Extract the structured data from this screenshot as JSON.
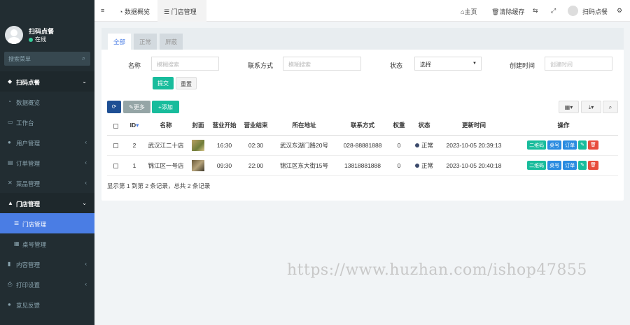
{
  "sidebar": {
    "user_name": "扫码点餐",
    "user_status": "在线",
    "search_placeholder": "搜索菜单",
    "items": [
      {
        "label": "扫码点餐",
        "icon": "cubes-icon"
      },
      {
        "label": "数据概览",
        "icon": "dashboard-icon"
      },
      {
        "label": "工作台",
        "icon": "desktop-icon"
      },
      {
        "label": "用户管理",
        "icon": "user-icon"
      },
      {
        "label": "订单管理",
        "icon": "list-icon"
      },
      {
        "label": "菜品管理",
        "icon": "cutlery-icon"
      },
      {
        "label": "门店管理",
        "icon": "store-icon"
      },
      {
        "label": "门店管理",
        "icon": "list-icon"
      },
      {
        "label": "桌号管理",
        "icon": "grid-icon"
      },
      {
        "label": "内容管理",
        "icon": "book-icon"
      },
      {
        "label": "打印设置",
        "icon": "printer-icon"
      },
      {
        "label": "意见反馈",
        "icon": "comment-icon"
      }
    ]
  },
  "topbar": {
    "tab1": "数据概览",
    "tab2": "门店管理",
    "home": "主页",
    "clear_cache": "清除缓存",
    "username": "扫码点餐"
  },
  "filter_tabs": [
    "全部",
    "正常",
    "屏蔽"
  ],
  "form": {
    "name_label": "名称",
    "name_placeholder": "模糊搜索",
    "contact_label": "联系方式",
    "contact_placeholder": "模糊搜索",
    "status_label": "状态",
    "status_value": "选择",
    "created_label": "创建时间",
    "created_placeholder": "创建时间",
    "submit": "提交",
    "reset": "重置"
  },
  "toolbar": {
    "more": "更多",
    "add": "添加"
  },
  "table": {
    "headers": [
      "ID",
      "名称",
      "封面",
      "营业开始",
      "营业结束",
      "所在地址",
      "联系方式",
      "权重",
      "状态",
      "更新时间",
      "操作"
    ],
    "rows": [
      {
        "id": "2",
        "name": "武汉江二十店",
        "start": "16:30",
        "end": "02:30",
        "address": "武汉东湖门路20号",
        "phone": "028-88881888",
        "weight": "0",
        "status": "正常",
        "updated": "2023-10-05 20:39:13"
      },
      {
        "id": "1",
        "name": "锦江区一号店",
        "start": "09:30",
        "end": "22:00",
        "address": "锦江区东大街15号",
        "phone": "13818881888",
        "weight": "0",
        "status": "正常",
        "updated": "2023-10-05 20:40:18"
      }
    ],
    "ops": [
      "二维码",
      "桌号",
      "订单"
    ]
  },
  "pager": "显示第 1 到第 2 条记录，总共 2 条记录",
  "watermark": "https://www.huzhan.com/ishop47855",
  "colors": {
    "sidebar": "#222d32",
    "accent": "#4a7de4",
    "teal": "#18bc9c"
  }
}
